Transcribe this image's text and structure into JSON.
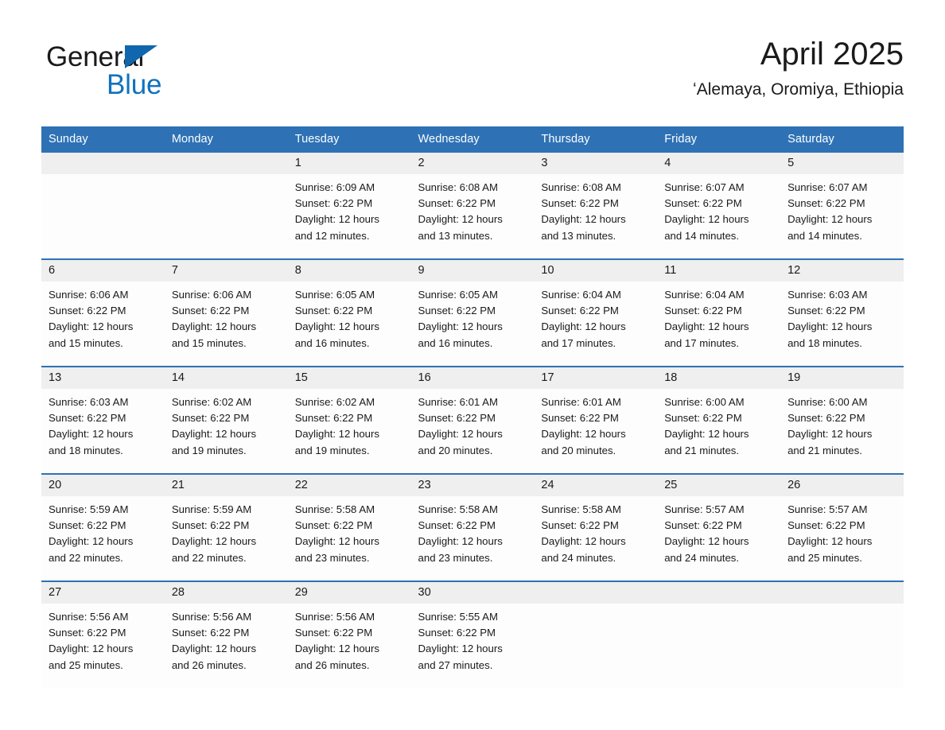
{
  "brand": {
    "name_part1": "General",
    "name_part2": "Blue",
    "triangle_icon": "triangle-icon",
    "accent_color": "#1172be",
    "text_color": "#1a1a1a"
  },
  "header": {
    "title": "April 2025",
    "location": "ʻAlemaya, Oromiya, Ethiopia"
  },
  "calendar": {
    "header_bg": "#2e72b5",
    "header_text_color": "#ffffff",
    "daynum_bg": "#efefef",
    "separator_color": "#2e72b5",
    "weekday_headers": [
      "Sunday",
      "Monday",
      "Tuesday",
      "Wednesday",
      "Thursday",
      "Friday",
      "Saturday"
    ],
    "weeks": [
      [
        {
          "day": "",
          "sunrise": "",
          "sunset": "",
          "daylight_line1": "",
          "daylight_line2": ""
        },
        {
          "day": "",
          "sunrise": "",
          "sunset": "",
          "daylight_line1": "",
          "daylight_line2": ""
        },
        {
          "day": "1",
          "sunrise": "Sunrise: 6:09 AM",
          "sunset": "Sunset: 6:22 PM",
          "daylight_line1": "Daylight: 12 hours",
          "daylight_line2": "and 12 minutes."
        },
        {
          "day": "2",
          "sunrise": "Sunrise: 6:08 AM",
          "sunset": "Sunset: 6:22 PM",
          "daylight_line1": "Daylight: 12 hours",
          "daylight_line2": "and 13 minutes."
        },
        {
          "day": "3",
          "sunrise": "Sunrise: 6:08 AM",
          "sunset": "Sunset: 6:22 PM",
          "daylight_line1": "Daylight: 12 hours",
          "daylight_line2": "and 13 minutes."
        },
        {
          "day": "4",
          "sunrise": "Sunrise: 6:07 AM",
          "sunset": "Sunset: 6:22 PM",
          "daylight_line1": "Daylight: 12 hours",
          "daylight_line2": "and 14 minutes."
        },
        {
          "day": "5",
          "sunrise": "Sunrise: 6:07 AM",
          "sunset": "Sunset: 6:22 PM",
          "daylight_line1": "Daylight: 12 hours",
          "daylight_line2": "and 14 minutes."
        }
      ],
      [
        {
          "day": "6",
          "sunrise": "Sunrise: 6:06 AM",
          "sunset": "Sunset: 6:22 PM",
          "daylight_line1": "Daylight: 12 hours",
          "daylight_line2": "and 15 minutes."
        },
        {
          "day": "7",
          "sunrise": "Sunrise: 6:06 AM",
          "sunset": "Sunset: 6:22 PM",
          "daylight_line1": "Daylight: 12 hours",
          "daylight_line2": "and 15 minutes."
        },
        {
          "day": "8",
          "sunrise": "Sunrise: 6:05 AM",
          "sunset": "Sunset: 6:22 PM",
          "daylight_line1": "Daylight: 12 hours",
          "daylight_line2": "and 16 minutes."
        },
        {
          "day": "9",
          "sunrise": "Sunrise: 6:05 AM",
          "sunset": "Sunset: 6:22 PM",
          "daylight_line1": "Daylight: 12 hours",
          "daylight_line2": "and 16 minutes."
        },
        {
          "day": "10",
          "sunrise": "Sunrise: 6:04 AM",
          "sunset": "Sunset: 6:22 PM",
          "daylight_line1": "Daylight: 12 hours",
          "daylight_line2": "and 17 minutes."
        },
        {
          "day": "11",
          "sunrise": "Sunrise: 6:04 AM",
          "sunset": "Sunset: 6:22 PM",
          "daylight_line1": "Daylight: 12 hours",
          "daylight_line2": "and 17 minutes."
        },
        {
          "day": "12",
          "sunrise": "Sunrise: 6:03 AM",
          "sunset": "Sunset: 6:22 PM",
          "daylight_line1": "Daylight: 12 hours",
          "daylight_line2": "and 18 minutes."
        }
      ],
      [
        {
          "day": "13",
          "sunrise": "Sunrise: 6:03 AM",
          "sunset": "Sunset: 6:22 PM",
          "daylight_line1": "Daylight: 12 hours",
          "daylight_line2": "and 18 minutes."
        },
        {
          "day": "14",
          "sunrise": "Sunrise: 6:02 AM",
          "sunset": "Sunset: 6:22 PM",
          "daylight_line1": "Daylight: 12 hours",
          "daylight_line2": "and 19 minutes."
        },
        {
          "day": "15",
          "sunrise": "Sunrise: 6:02 AM",
          "sunset": "Sunset: 6:22 PM",
          "daylight_line1": "Daylight: 12 hours",
          "daylight_line2": "and 19 minutes."
        },
        {
          "day": "16",
          "sunrise": "Sunrise: 6:01 AM",
          "sunset": "Sunset: 6:22 PM",
          "daylight_line1": "Daylight: 12 hours",
          "daylight_line2": "and 20 minutes."
        },
        {
          "day": "17",
          "sunrise": "Sunrise: 6:01 AM",
          "sunset": "Sunset: 6:22 PM",
          "daylight_line1": "Daylight: 12 hours",
          "daylight_line2": "and 20 minutes."
        },
        {
          "day": "18",
          "sunrise": "Sunrise: 6:00 AM",
          "sunset": "Sunset: 6:22 PM",
          "daylight_line1": "Daylight: 12 hours",
          "daylight_line2": "and 21 minutes."
        },
        {
          "day": "19",
          "sunrise": "Sunrise: 6:00 AM",
          "sunset": "Sunset: 6:22 PM",
          "daylight_line1": "Daylight: 12 hours",
          "daylight_line2": "and 21 minutes."
        }
      ],
      [
        {
          "day": "20",
          "sunrise": "Sunrise: 5:59 AM",
          "sunset": "Sunset: 6:22 PM",
          "daylight_line1": "Daylight: 12 hours",
          "daylight_line2": "and 22 minutes."
        },
        {
          "day": "21",
          "sunrise": "Sunrise: 5:59 AM",
          "sunset": "Sunset: 6:22 PM",
          "daylight_line1": "Daylight: 12 hours",
          "daylight_line2": "and 22 minutes."
        },
        {
          "day": "22",
          "sunrise": "Sunrise: 5:58 AM",
          "sunset": "Sunset: 6:22 PM",
          "daylight_line1": "Daylight: 12 hours",
          "daylight_line2": "and 23 minutes."
        },
        {
          "day": "23",
          "sunrise": "Sunrise: 5:58 AM",
          "sunset": "Sunset: 6:22 PM",
          "daylight_line1": "Daylight: 12 hours",
          "daylight_line2": "and 23 minutes."
        },
        {
          "day": "24",
          "sunrise": "Sunrise: 5:58 AM",
          "sunset": "Sunset: 6:22 PM",
          "daylight_line1": "Daylight: 12 hours",
          "daylight_line2": "and 24 minutes."
        },
        {
          "day": "25",
          "sunrise": "Sunrise: 5:57 AM",
          "sunset": "Sunset: 6:22 PM",
          "daylight_line1": "Daylight: 12 hours",
          "daylight_line2": "and 24 minutes."
        },
        {
          "day": "26",
          "sunrise": "Sunrise: 5:57 AM",
          "sunset": "Sunset: 6:22 PM",
          "daylight_line1": "Daylight: 12 hours",
          "daylight_line2": "and 25 minutes."
        }
      ],
      [
        {
          "day": "27",
          "sunrise": "Sunrise: 5:56 AM",
          "sunset": "Sunset: 6:22 PM",
          "daylight_line1": "Daylight: 12 hours",
          "daylight_line2": "and 25 minutes."
        },
        {
          "day": "28",
          "sunrise": "Sunrise: 5:56 AM",
          "sunset": "Sunset: 6:22 PM",
          "daylight_line1": "Daylight: 12 hours",
          "daylight_line2": "and 26 minutes."
        },
        {
          "day": "29",
          "sunrise": "Sunrise: 5:56 AM",
          "sunset": "Sunset: 6:22 PM",
          "daylight_line1": "Daylight: 12 hours",
          "daylight_line2": "and 26 minutes."
        },
        {
          "day": "30",
          "sunrise": "Sunrise: 5:55 AM",
          "sunset": "Sunset: 6:22 PM",
          "daylight_line1": "Daylight: 12 hours",
          "daylight_line2": "and 27 minutes."
        },
        {
          "day": "",
          "sunrise": "",
          "sunset": "",
          "daylight_line1": "",
          "daylight_line2": ""
        },
        {
          "day": "",
          "sunrise": "",
          "sunset": "",
          "daylight_line1": "",
          "daylight_line2": ""
        },
        {
          "day": "",
          "sunrise": "",
          "sunset": "",
          "daylight_line1": "",
          "daylight_line2": ""
        }
      ]
    ]
  }
}
